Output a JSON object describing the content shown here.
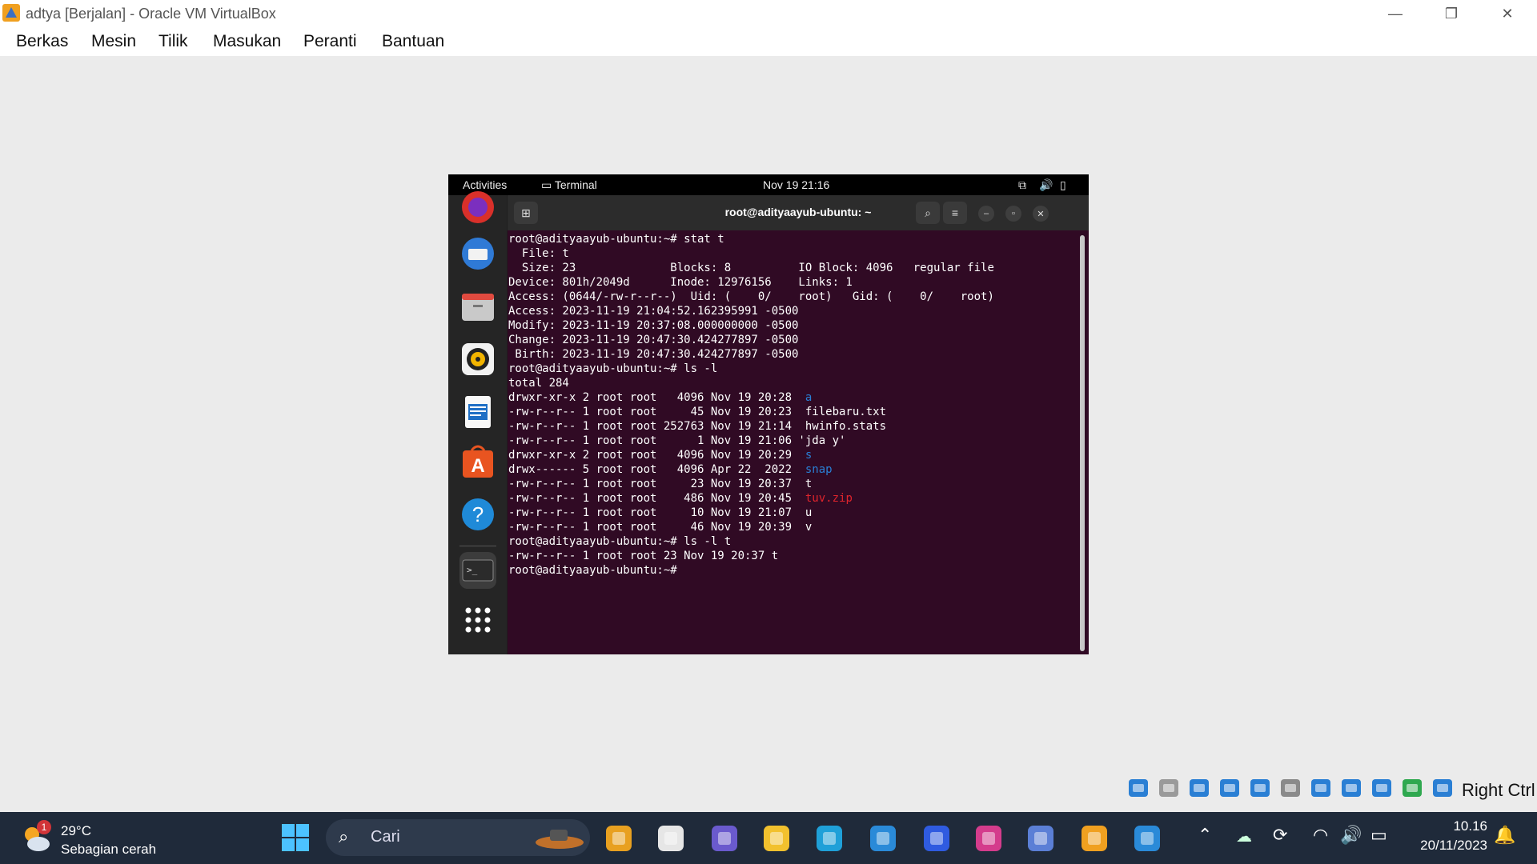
{
  "window": {
    "title": "adtya [Berjalan] - Oracle VM VirtualBox",
    "min_glyph": "—",
    "max_glyph": "❐",
    "close_glyph": "✕"
  },
  "menubar": {
    "items": [
      "Berkas",
      "Mesin",
      "Tilik",
      "Masukan",
      "Peranti",
      "Bantuan"
    ]
  },
  "ubuntu": {
    "topbar": {
      "activities": "Activities",
      "app": "Terminal",
      "datetime": "Nov 19  21:16"
    },
    "dock_icons": [
      "firefox-icon",
      "thunderbird-icon",
      "files-icon",
      "rhythmbox-icon",
      "writer-icon",
      "app-center-icon",
      "help-icon",
      "terminal-icon",
      "show-apps-icon"
    ],
    "terminal": {
      "title": "root@adityaayub-ubuntu: ~",
      "lines": [
        [
          {
            "t": "root@adityaayub-ubuntu:~# stat t",
            "c": ""
          }
        ],
        [
          {
            "t": "  File: t",
            "c": ""
          }
        ],
        [
          {
            "t": "  Size: 23              Blocks: 8          IO Block: 4096   regular file",
            "c": ""
          }
        ],
        [
          {
            "t": "Device: 801h/2049d      Inode: 12976156    Links: 1",
            "c": ""
          }
        ],
        [
          {
            "t": "Access: (0644/-rw-r--r--)  Uid: (    0/    root)   Gid: (    0/    root)",
            "c": ""
          }
        ],
        [
          {
            "t": "Access: 2023-11-19 21:04:52.162395991 -0500",
            "c": ""
          }
        ],
        [
          {
            "t": "Modify: 2023-11-19 20:37:08.000000000 -0500",
            "c": ""
          }
        ],
        [
          {
            "t": "Change: 2023-11-19 20:47:30.424277897 -0500",
            "c": ""
          }
        ],
        [
          {
            "t": " Birth: 2023-11-19 20:47:30.424277897 -0500",
            "c": ""
          }
        ],
        [
          {
            "t": "root@adityaayub-ubuntu:~# ls -l",
            "c": ""
          }
        ],
        [
          {
            "t": "total 284",
            "c": ""
          }
        ],
        [
          {
            "t": "drwxr-xr-x 2 root root   4096 Nov 19 20:28  ",
            "c": ""
          },
          {
            "t": "a",
            "c": "blue"
          }
        ],
        [
          {
            "t": "-rw-r--r-- 1 root root     45 Nov 19 20:23  filebaru.txt",
            "c": ""
          }
        ],
        [
          {
            "t": "-rw-r--r-- 1 root root 252763 Nov 19 21:14  hwinfo.stats",
            "c": ""
          }
        ],
        [
          {
            "t": "-rw-r--r-- 1 root root      1 Nov 19 21:06 'jda y'",
            "c": ""
          }
        ],
        [
          {
            "t": "drwxr-xr-x 2 root root   4096 Nov 19 20:29  ",
            "c": ""
          },
          {
            "t": "s",
            "c": "blue"
          }
        ],
        [
          {
            "t": "drwx------ 5 root root   4096 Apr 22  2022  ",
            "c": ""
          },
          {
            "t": "snap",
            "c": "blue"
          }
        ],
        [
          {
            "t": "-rw-r--r-- 1 root root     23 Nov 19 20:37  t",
            "c": ""
          }
        ],
        [
          {
            "t": "-rw-r--r-- 1 root root    486 Nov 19 20:45  ",
            "c": ""
          },
          {
            "t": "tuv.zip",
            "c": "red"
          }
        ],
        [
          {
            "t": "-rw-r--r-- 1 root root     10 Nov 19 21:07  u",
            "c": ""
          }
        ],
        [
          {
            "t": "-rw-r--r-- 1 root root     46 Nov 19 20:39  v",
            "c": ""
          }
        ],
        [
          {
            "t": "root@adityaayub-ubuntu:~# ls -l t",
            "c": ""
          }
        ],
        [
          {
            "t": "-rw-r--r-- 1 root root 23 Nov 19 20:37 t",
            "c": ""
          }
        ],
        [
          {
            "t": "root@adityaayub-ubuntu:~# ",
            "c": ""
          }
        ]
      ]
    }
  },
  "vbox_status": {
    "icons": [
      "hard-disk-icon",
      "optical-drive-icon",
      "audio-icon",
      "network-icon",
      "usb-icon",
      "shared-folders-icon",
      "display-icon",
      "recording-icon",
      "vt-x-icon",
      "mouse-integration-icon",
      "download-icon"
    ],
    "host_key": "Right Ctrl"
  },
  "taskbar": {
    "weather": {
      "temp": "29°C",
      "desc": "Sebagian cerah",
      "badge": "1"
    },
    "search_placeholder": "Cari",
    "apps": [
      "start-icon",
      "copilot-icon",
      "task-view-icon",
      "teams-icon",
      "file-explorer-icon",
      "edge-icon",
      "store-icon",
      "app-icon",
      "instagram-icon",
      "virtualbox-cube-icon",
      "virtualbox-icon",
      "paint-icon"
    ],
    "clock": {
      "time": "10.16",
      "date": "20/11/2023"
    }
  },
  "colors": {
    "terminal_bg": "#300a24",
    "dir_blue": "#2a7fd4",
    "zip_red": "#e0242c",
    "taskbar_bg": "#1f2a3a"
  }
}
